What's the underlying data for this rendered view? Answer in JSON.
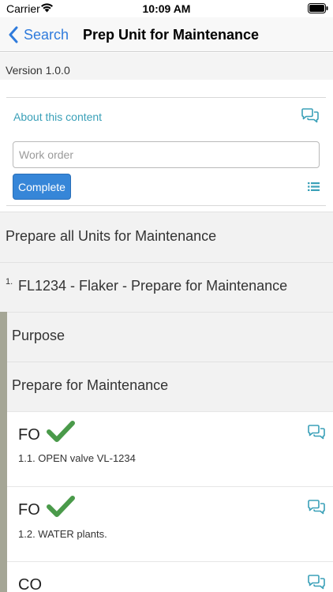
{
  "status_bar": {
    "carrier": "Carrier",
    "time": "10:09 AM"
  },
  "nav": {
    "back_label": "Search",
    "title": "Prep Unit for Maintenance"
  },
  "version": "Version 1.0.0",
  "header_card": {
    "about_link": "About this content",
    "work_order_placeholder": "Work order",
    "complete_label": "Complete"
  },
  "sections": {
    "top": "Prepare all Units for Maintenance",
    "procedure_number": "1.",
    "procedure_title": "FL1234 - Flaker - Prepare for Maintenance",
    "purpose": "Purpose",
    "prepare": "Prepare for Maintenance"
  },
  "steps": [
    {
      "role": "FO",
      "text": "1.1.  OPEN valve VL-1234",
      "completed": true
    },
    {
      "role": "FO",
      "text": "1.2.  WATER plants.",
      "completed": true
    },
    {
      "role": "CO",
      "text": "",
      "completed": false
    }
  ],
  "colors": {
    "accent": "#3aa0b8",
    "link_blue": "#2f7bdc",
    "check_green": "#4a9a4a",
    "button_blue": "#3686d8"
  }
}
